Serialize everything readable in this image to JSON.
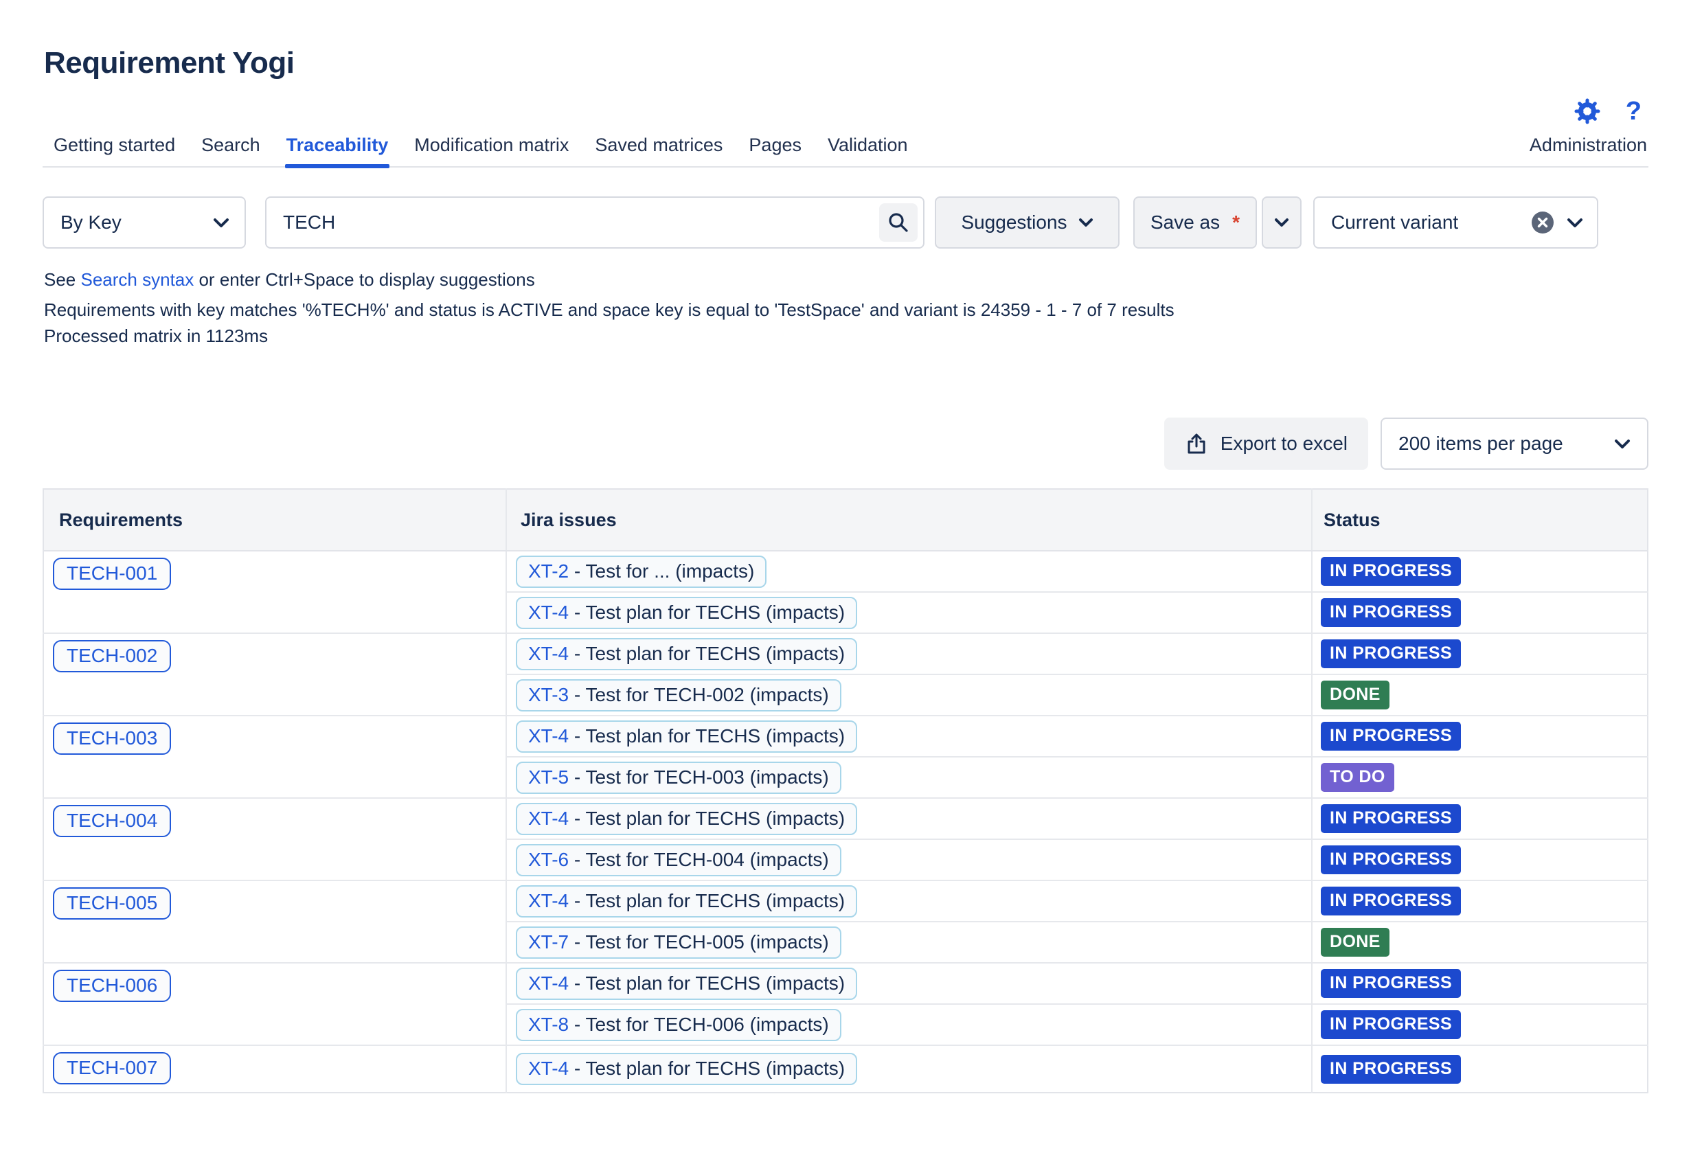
{
  "app": {
    "title": "Requirement Yogi"
  },
  "tabs": [
    {
      "label": "Getting started",
      "active": false
    },
    {
      "label": "Search",
      "active": false
    },
    {
      "label": "Traceability",
      "active": true
    },
    {
      "label": "Modification matrix",
      "active": false
    },
    {
      "label": "Saved matrices",
      "active": false
    },
    {
      "label": "Pages",
      "active": false
    },
    {
      "label": "Validation",
      "active": false
    }
  ],
  "admin_tab": {
    "label": "Administration"
  },
  "header_icons": {
    "gear": "settings-gear",
    "help": "?"
  },
  "search": {
    "scope_value": "By Key",
    "query": "TECH",
    "suggestions_label": "Suggestions",
    "save_as_label": "Save as",
    "required_marker": "*",
    "variant_value": "Current variant"
  },
  "hints": {
    "see_prefix": "See ",
    "syntax_link": "Search syntax",
    "see_suffix": " or enter Ctrl+Space to display suggestions",
    "summary": "Requirements with key matches '%TECH%' and status is ACTIVE and space key is equal to 'TestSpace' and variant is 24359 - 1 - 7 of 7 results",
    "processed": "Processed matrix in 1123ms"
  },
  "toolbar": {
    "export_label": "Export to excel",
    "page_size_value": "200 items per page"
  },
  "table": {
    "columns": [
      "Requirements",
      "Jira issues",
      "Status"
    ],
    "rows": [
      {
        "requirement": "TECH-001",
        "issues": [
          {
            "key": "XT-2",
            "suffix": " - Test for ... (impacts)",
            "status": "IN PROGRESS"
          },
          {
            "key": "XT-4",
            "suffix": " - Test plan for TECHS (impacts)",
            "status": "IN PROGRESS"
          }
        ]
      },
      {
        "requirement": "TECH-002",
        "issues": [
          {
            "key": "XT-4",
            "suffix": " - Test plan for TECHS (impacts)",
            "status": "IN PROGRESS"
          },
          {
            "key": "XT-3",
            "suffix": " - Test for TECH-002 (impacts)",
            "status": "DONE"
          }
        ]
      },
      {
        "requirement": "TECH-003",
        "issues": [
          {
            "key": "XT-4",
            "suffix": " - Test plan for TECHS (impacts)",
            "status": "IN PROGRESS"
          },
          {
            "key": "XT-5",
            "suffix": " - Test for TECH-003 (impacts)",
            "status": "TO DO"
          }
        ]
      },
      {
        "requirement": "TECH-004",
        "issues": [
          {
            "key": "XT-4",
            "suffix": " - Test plan for TECHS (impacts)",
            "status": "IN PROGRESS"
          },
          {
            "key": "XT-6",
            "suffix": " - Test for TECH-004 (impacts)",
            "status": "IN PROGRESS"
          }
        ]
      },
      {
        "requirement": "TECH-005",
        "issues": [
          {
            "key": "XT-4",
            "suffix": " - Test plan for TECHS (impacts)",
            "status": "IN PROGRESS"
          },
          {
            "key": "XT-7",
            "suffix": " - Test for TECH-005 (impacts)",
            "status": "DONE"
          }
        ]
      },
      {
        "requirement": "TECH-006",
        "issues": [
          {
            "key": "XT-4",
            "suffix": " - Test plan for TECHS (impacts)",
            "status": "IN PROGRESS"
          },
          {
            "key": "XT-8",
            "suffix": " - Test for TECH-006 (impacts)",
            "status": "IN PROGRESS"
          }
        ]
      },
      {
        "requirement": "TECH-007",
        "issues": [
          {
            "key": "XT-4",
            "suffix": " - Test plan for TECHS (impacts)",
            "status": "IN PROGRESS"
          }
        ]
      }
    ]
  },
  "colors": {
    "accent_blue": "#2159D9",
    "text_navy": "#172B4D",
    "status_in_progress": "#1C49CE",
    "status_done": "#2F7D53",
    "status_to_do": "#7261D1",
    "asterisk_red": "#D8432F"
  },
  "status_colors": {
    "IN PROGRESS": "#1C49CE",
    "DONE": "#2F7D53",
    "TO DO": "#7261D1"
  }
}
